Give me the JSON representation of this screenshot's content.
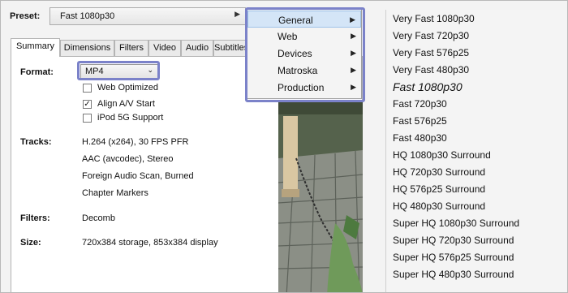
{
  "preset": {
    "label": "Preset:",
    "value": "Fast 1080p30"
  },
  "tabs": [
    {
      "label": "Summary"
    },
    {
      "label": "Dimensions"
    },
    {
      "label": "Filters"
    },
    {
      "label": "Video"
    },
    {
      "label": "Audio"
    },
    {
      "label": "Subtitles"
    }
  ],
  "summary": {
    "format_label": "Format:",
    "format_value": "MP4",
    "options": [
      {
        "label": "Web Optimized",
        "checked": false
      },
      {
        "label": "Align A/V Start",
        "checked": true
      },
      {
        "label": "iPod 5G Support",
        "checked": false
      }
    ],
    "tracks_label": "Tracks:",
    "tracks": [
      "H.264 (x264), 30 FPS PFR",
      "AAC (avcodec), Stereo",
      "Foreign Audio Scan, Burned",
      "Chapter Markers"
    ],
    "filters_label": "Filters:",
    "filters_value": "Decomb",
    "size_label": "Size:",
    "size_value": "720x384 storage, 853x384 display"
  },
  "submenu": {
    "items": [
      {
        "label": "General"
      },
      {
        "label": "Web"
      },
      {
        "label": "Devices"
      },
      {
        "label": "Matroska"
      },
      {
        "label": "Production"
      }
    ]
  },
  "preset_list": [
    "Very Fast 1080p30",
    "Very Fast 720p30",
    "Very Fast 576p25",
    "Very Fast 480p30",
    "Fast 1080p30",
    "Fast 720p30",
    "Fast 576p25",
    "Fast 480p30",
    "HQ 1080p30 Surround",
    "HQ 720p30 Surround",
    "HQ 576p25 Surround",
    "HQ 480p30 Surround",
    "Super HQ 1080p30 Surround",
    "Super HQ 720p30 Surround",
    "Super HQ 576p25 Surround",
    "Super HQ 480p30 Surround"
  ],
  "colors": {
    "highlight_border": "#7b82c9",
    "menu_selected": "#d4e5f7"
  }
}
